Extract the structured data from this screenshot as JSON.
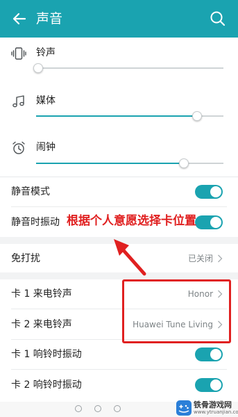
{
  "header": {
    "title": "声音"
  },
  "volume": {
    "ringtone": {
      "label": "铃声",
      "level": 0.01
    },
    "media": {
      "label": "媒体",
      "level": 0.86
    },
    "alarm": {
      "label": "闹钟",
      "level": 0.79
    }
  },
  "toggles": {
    "silent_mode": {
      "label": "静音模式",
      "on": true
    },
    "silent_vibrate": {
      "label": "静音时振动",
      "on": true
    }
  },
  "do_not_disturb": {
    "label": "免打扰",
    "value": "已关闭"
  },
  "ringtones": {
    "sim1": {
      "label": "卡 1 来电铃声",
      "value": "Honor"
    },
    "sim2": {
      "label": "卡 2 来电铃声",
      "value": "Huawei Tune Living"
    }
  },
  "vibrate": {
    "sim1": {
      "label": "卡 1 响铃时振动",
      "on": true
    },
    "sim2": {
      "label": "卡 2 响铃时振动",
      "on": true
    }
  },
  "annotation": {
    "text": "根据个人意愿选择卡位置"
  },
  "watermark": {
    "text": "铁骨游戏网",
    "url": "www.ytruanjian.com"
  },
  "colors": {
    "accent": "#1aa3b0",
    "annotation": "#e02020"
  },
  "icons": [
    "back-arrow-icon",
    "search-icon",
    "vibrate-icon",
    "music-note-icon",
    "alarm-clock-icon",
    "chevron-right-icon"
  ]
}
